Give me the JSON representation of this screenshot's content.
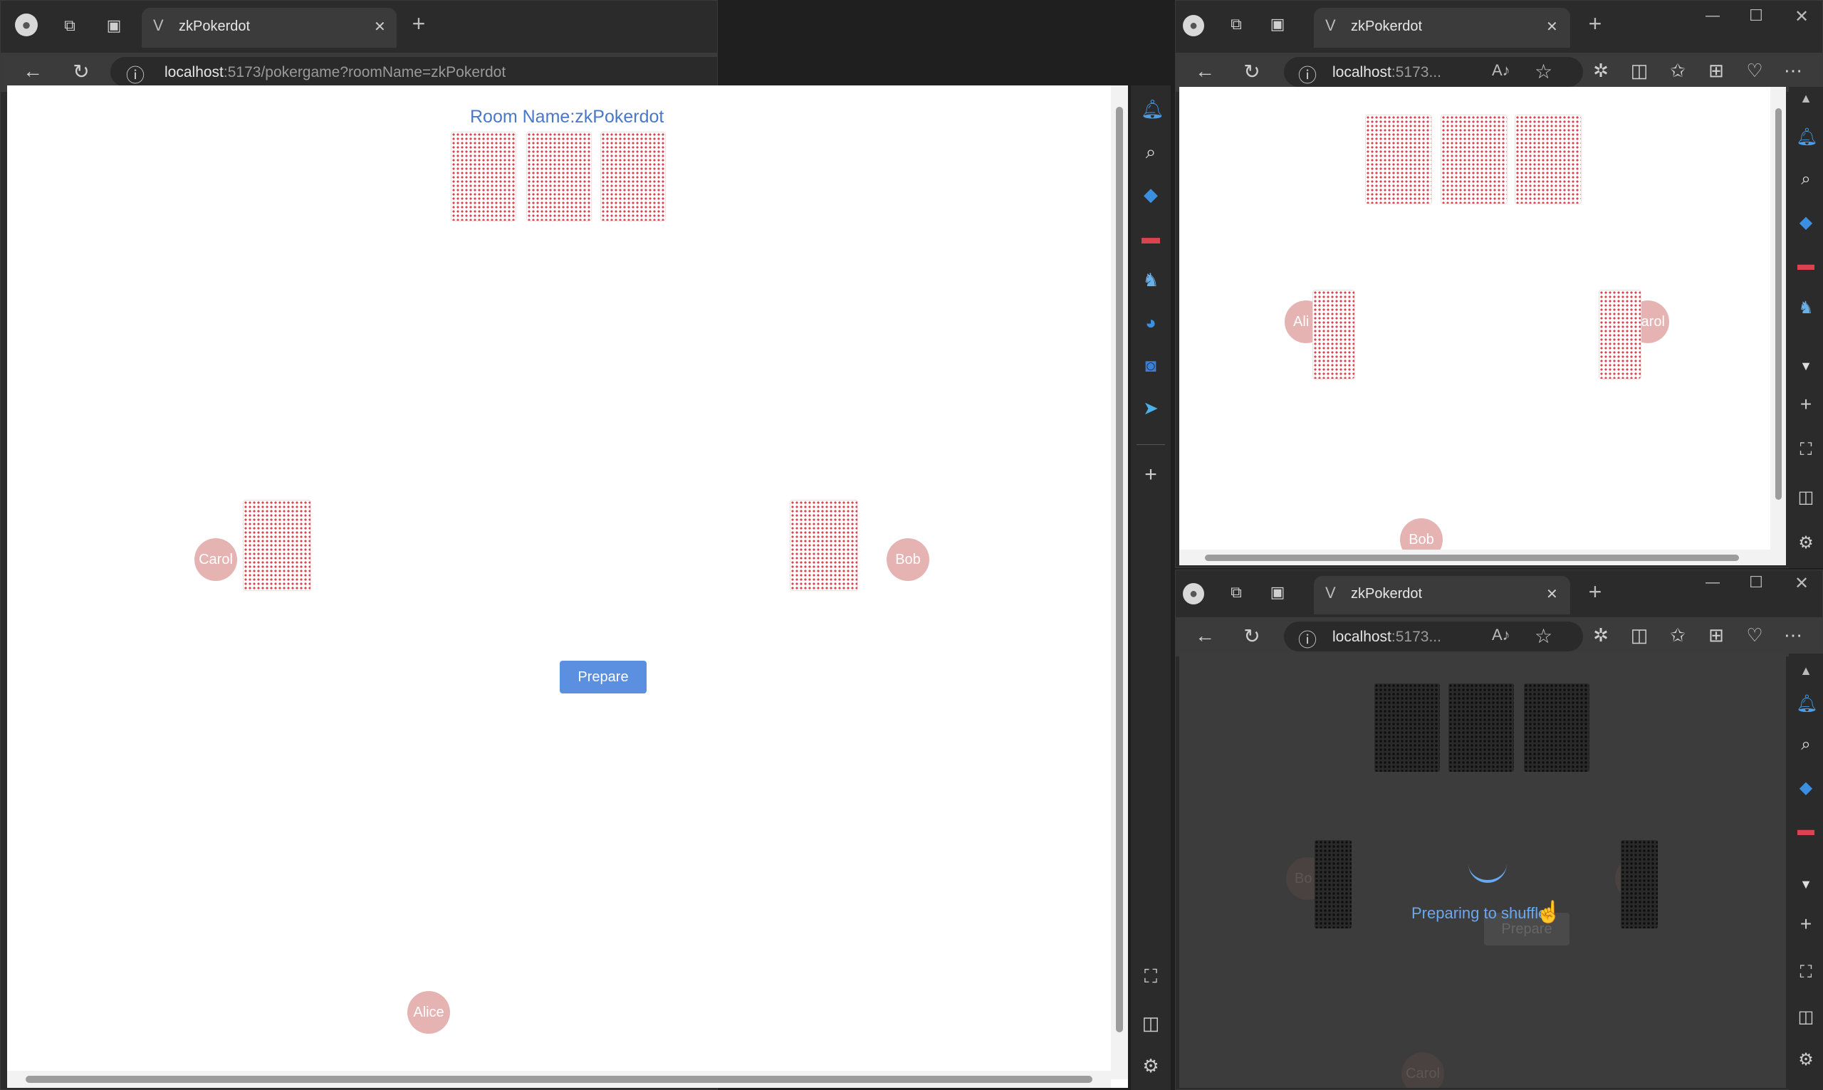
{
  "browser": {
    "tab_title": "zkPokerdot",
    "tab_favicon": "V",
    "new_tab": "+",
    "url_host": "localhost",
    "url_path": ":5173/pokergame?roomName=zkPokerdot",
    "url_short_host": "localhost",
    "url_short_path": ":5173...",
    "min": "—",
    "max": "☐",
    "close": "✕"
  },
  "game": {
    "room_name": "Room Name:zkPokerdot",
    "players": [
      "Carol",
      "Bob",
      "Alice"
    ],
    "prepare_label": "Prepare",
    "overlay_text": "Preparing to shuffle",
    "partial_alice": "Ali",
    "partial_carol": "Carol",
    "partial_bo": "Bo",
    "partial_ce": "ce"
  },
  "colors": {
    "card_back": "#d9444e",
    "avatar": "#e6b3b3",
    "accent": "#5b8fe0",
    "room_text": "#4a78c8"
  },
  "icons": [
    "profile-icon",
    "workspaces-icon",
    "tab-actions-icon",
    "back-icon",
    "refresh-icon",
    "info-icon",
    "read-aloud-icon",
    "favorite-icon",
    "extensions-icon",
    "split-screen-icon",
    "favorites-icon",
    "collections-icon",
    "heart-icon",
    "more-icon",
    "bell-icon",
    "search-icon",
    "tag-icon",
    "toolbox-icon",
    "chess-icon",
    "edge-drop-icon",
    "outlook-icon",
    "send-icon",
    "add-icon",
    "screenshot-icon",
    "sidebar-toggle-icon",
    "settings-icon"
  ]
}
